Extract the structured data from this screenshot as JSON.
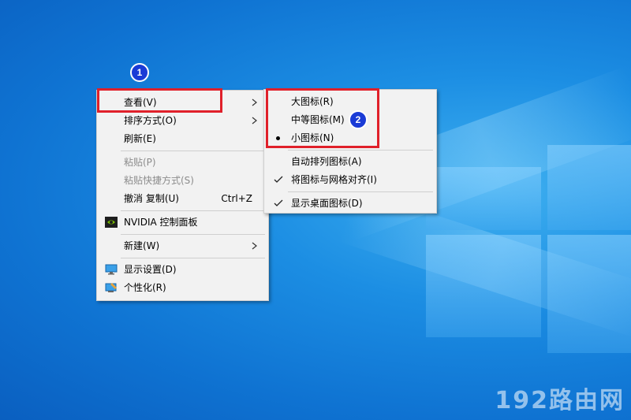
{
  "context_menu": {
    "items": [
      {
        "label": "查看(V)",
        "has_submenu": true
      },
      {
        "label": "排序方式(O)",
        "has_submenu": true
      },
      {
        "label": "刷新(E)"
      },
      {
        "label": "粘贴(P)",
        "disabled": true
      },
      {
        "label": "粘贴快捷方式(S)",
        "disabled": true
      },
      {
        "label": "撤消 复制(U)",
        "shortcut": "Ctrl+Z"
      },
      {
        "label": "NVIDIA 控制面板",
        "icon": "nvidia-icon"
      },
      {
        "label": "新建(W)",
        "has_submenu": true
      },
      {
        "label": "显示设置(D)",
        "icon": "display-settings-icon"
      },
      {
        "label": "个性化(R)",
        "icon": "personalize-icon"
      }
    ]
  },
  "view_submenu": {
    "items": [
      {
        "label": "大图标(R)"
      },
      {
        "label": "中等图标(M)"
      },
      {
        "label": "小图标(N)",
        "selected": true
      },
      {
        "label": "自动排列图标(A)"
      },
      {
        "label": "将图标与网格对齐(I)",
        "checked": true
      },
      {
        "label": "显示桌面图标(D)",
        "checked": true
      }
    ]
  },
  "badges": {
    "one": "1",
    "two": "2"
  },
  "watermark": "192路由网",
  "colors": {
    "highlight": "#e0202a",
    "badge": "#1a3bd6",
    "desktop": "#0f73d2"
  }
}
